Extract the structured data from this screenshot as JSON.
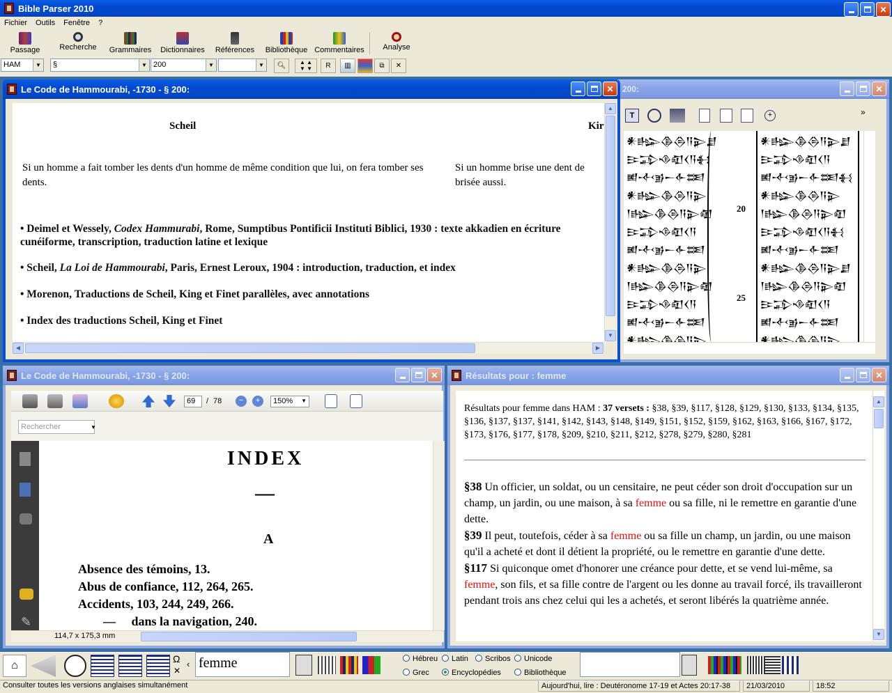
{
  "app": {
    "title": "Bible Parser 2010"
  },
  "menu": [
    "Fichier",
    "Outils",
    "Fenêtre",
    "?"
  ],
  "toolbar": {
    "items": [
      {
        "label": "Passage",
        "icon": "passage-book-icon"
      },
      {
        "label": "Recherche",
        "icon": "search-magnifier-icon"
      },
      {
        "label": "Grammaires",
        "icon": "grammar-books-icon"
      },
      {
        "label": "Dictionnaires",
        "icon": "dictionary-icon"
      },
      {
        "label": "Références",
        "icon": "references-icon"
      },
      {
        "label": "Bibliothèque",
        "icon": "library-icon"
      },
      {
        "label": "Commentaires",
        "icon": "commentary-icon"
      },
      {
        "label": "Analyse",
        "icon": "analysis-icon"
      }
    ]
  },
  "selectors": {
    "version": "HAM",
    "book": "§",
    "chapter": "200",
    "verse": "",
    "r_label": "R"
  },
  "win1": {
    "title": "Le Code de Hammourabi, -1730 - § 200:",
    "col1_heading": "Scheil",
    "col2_heading": "Kir",
    "col1_text": "Si un homme a fait tomber les dents d'un homme de même condition que lui, on fera tomber ses dents.",
    "col2_text": "Si un homme brise une dent de brisée aussi.",
    "refs": [
      {
        "pre": "• Deimel et Wessely, ",
        "it": "Codex Hammurabi",
        "post": ", Rome, Sumptibus Pontificii Instituti Biblici, 1930 : texte akkadien en écriture cunéiforme, transcription, traduction latine et lexique"
      },
      {
        "pre": "• Scheil, ",
        "it": "La Loi de Hammourabi",
        "post": ", Paris, Ernest Leroux, 1904 : introduction, traduction, et index"
      },
      {
        "pre": "• Morenon, Traductions de Scheil, King et Finet parallèles, avec annotations",
        "it": "",
        "post": ""
      },
      {
        "pre": "• Index des traductions Scheil, King et Finet",
        "it": "",
        "post": ""
      }
    ]
  },
  "win2": {
    "title": "200:",
    "line_numbers": [
      "20",
      "25"
    ]
  },
  "win3": {
    "title": "Le Code de Hammourabi, -1730 - § 200:",
    "page_current": "69",
    "page_sep": "/",
    "page_total": "78",
    "zoom": "150%",
    "search_placeholder": "Rechercher",
    "page_size": "114,7 x 175,3 mm",
    "pdf_heading": "INDEX",
    "pdf_dash": "—",
    "pdf_letter": "A",
    "pdf_lines": [
      "Absence des témoins, 13.",
      "Abus de confiance, 112, 264, 265.",
      "Accidents, 103, 244, 249, 266.",
      "—     dans la navigation, 240."
    ]
  },
  "win4": {
    "title": "Résultats pour : femme",
    "summary_pre": "Résultats pour femme dans HAM : ",
    "summary_count": "37 versets :",
    "summary_list": " §38, §39, §117, §128, §129, §130, §133, §134, §135, §136, §137, §137, §141, §142, §143, §148, §149, §151, §152, §159, §162, §163, §166, §167, §172, §173, §176, §177, §178, §209, §210, §211, §212, §278, §279, §280, §281",
    "verses": [
      {
        "ref": "§38",
        "a": " Un officier, un soldat, ou un censitaire, ne peut céder son droit d'occupation sur un champ, un jardin, ou une maison, à sa ",
        "hl": "femme",
        "b": " ou sa fille, ni le remettre en garantie d'une dette."
      },
      {
        "ref": "§39",
        "a": " Il peut, toutefois, céder à sa ",
        "hl": "femme",
        "b": " ou sa fille un champ, un jardin, ou une maison qu'il a acheté et dont il détient la propriété, ou le remettre en garantie d'une dette."
      },
      {
        "ref": "§117",
        "a": " Si quiconque omet d'honorer une créance pour dette, et se vend lui-même, sa ",
        "hl": "femme",
        "b": ", son fils, et sa fille contre de l'argent ou les donne au travail forcé, ils travailleront pendant trois ans chez celui qui les a achetés, et seront libérés la quatrième année."
      }
    ]
  },
  "bottom": {
    "search_value": "femme",
    "omega": "Ω",
    "radios": [
      {
        "label": "Hébreu",
        "checked": false
      },
      {
        "label": "Latin",
        "checked": false
      },
      {
        "label": "Scribos",
        "checked": false
      },
      {
        "label": "Unicode",
        "checked": false
      },
      {
        "label": "Grec",
        "checked": false
      },
      {
        "label": "Encyclopédies",
        "checked": true
      },
      {
        "label": "Bibliothèque",
        "checked": false
      }
    ]
  },
  "status": {
    "hint": "Consulter toutes les versions anglaises simultanément",
    "reading": "Aujourd'hui, lire : Deutéronome 17-19 et Actes 20:17-38",
    "date": "21/03/2010",
    "time": "18:52"
  }
}
